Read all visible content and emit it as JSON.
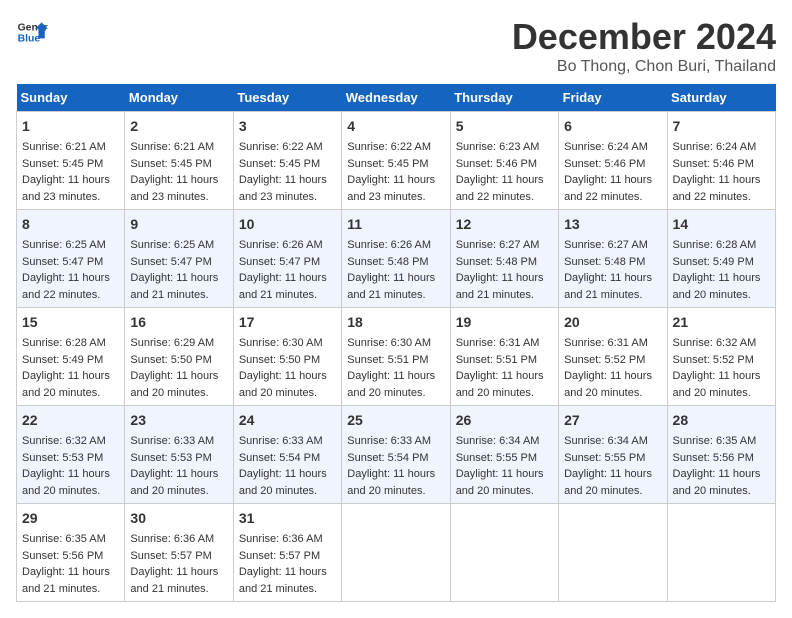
{
  "header": {
    "logo_line1": "General",
    "logo_line2": "Blue",
    "month_title": "December 2024",
    "location": "Bo Thong, Chon Buri, Thailand"
  },
  "weekdays": [
    "Sunday",
    "Monday",
    "Tuesday",
    "Wednesday",
    "Thursday",
    "Friday",
    "Saturday"
  ],
  "weeks": [
    [
      {
        "day": "1",
        "lines": [
          "Sunrise: 6:21 AM",
          "Sunset: 5:45 PM",
          "Daylight: 11 hours",
          "and 23 minutes."
        ]
      },
      {
        "day": "2",
        "lines": [
          "Sunrise: 6:21 AM",
          "Sunset: 5:45 PM",
          "Daylight: 11 hours",
          "and 23 minutes."
        ]
      },
      {
        "day": "3",
        "lines": [
          "Sunrise: 6:22 AM",
          "Sunset: 5:45 PM",
          "Daylight: 11 hours",
          "and 23 minutes."
        ]
      },
      {
        "day": "4",
        "lines": [
          "Sunrise: 6:22 AM",
          "Sunset: 5:45 PM",
          "Daylight: 11 hours",
          "and 23 minutes."
        ]
      },
      {
        "day": "5",
        "lines": [
          "Sunrise: 6:23 AM",
          "Sunset: 5:46 PM",
          "Daylight: 11 hours",
          "and 22 minutes."
        ]
      },
      {
        "day": "6",
        "lines": [
          "Sunrise: 6:24 AM",
          "Sunset: 5:46 PM",
          "Daylight: 11 hours",
          "and 22 minutes."
        ]
      },
      {
        "day": "7",
        "lines": [
          "Sunrise: 6:24 AM",
          "Sunset: 5:46 PM",
          "Daylight: 11 hours",
          "and 22 minutes."
        ]
      }
    ],
    [
      {
        "day": "8",
        "lines": [
          "Sunrise: 6:25 AM",
          "Sunset: 5:47 PM",
          "Daylight: 11 hours",
          "and 22 minutes."
        ]
      },
      {
        "day": "9",
        "lines": [
          "Sunrise: 6:25 AM",
          "Sunset: 5:47 PM",
          "Daylight: 11 hours",
          "and 21 minutes."
        ]
      },
      {
        "day": "10",
        "lines": [
          "Sunrise: 6:26 AM",
          "Sunset: 5:47 PM",
          "Daylight: 11 hours",
          "and 21 minutes."
        ]
      },
      {
        "day": "11",
        "lines": [
          "Sunrise: 6:26 AM",
          "Sunset: 5:48 PM",
          "Daylight: 11 hours",
          "and 21 minutes."
        ]
      },
      {
        "day": "12",
        "lines": [
          "Sunrise: 6:27 AM",
          "Sunset: 5:48 PM",
          "Daylight: 11 hours",
          "and 21 minutes."
        ]
      },
      {
        "day": "13",
        "lines": [
          "Sunrise: 6:27 AM",
          "Sunset: 5:48 PM",
          "Daylight: 11 hours",
          "and 21 minutes."
        ]
      },
      {
        "day": "14",
        "lines": [
          "Sunrise: 6:28 AM",
          "Sunset: 5:49 PM",
          "Daylight: 11 hours",
          "and 20 minutes."
        ]
      }
    ],
    [
      {
        "day": "15",
        "lines": [
          "Sunrise: 6:28 AM",
          "Sunset: 5:49 PM",
          "Daylight: 11 hours",
          "and 20 minutes."
        ]
      },
      {
        "day": "16",
        "lines": [
          "Sunrise: 6:29 AM",
          "Sunset: 5:50 PM",
          "Daylight: 11 hours",
          "and 20 minutes."
        ]
      },
      {
        "day": "17",
        "lines": [
          "Sunrise: 6:30 AM",
          "Sunset: 5:50 PM",
          "Daylight: 11 hours",
          "and 20 minutes."
        ]
      },
      {
        "day": "18",
        "lines": [
          "Sunrise: 6:30 AM",
          "Sunset: 5:51 PM",
          "Daylight: 11 hours",
          "and 20 minutes."
        ]
      },
      {
        "day": "19",
        "lines": [
          "Sunrise: 6:31 AM",
          "Sunset: 5:51 PM",
          "Daylight: 11 hours",
          "and 20 minutes."
        ]
      },
      {
        "day": "20",
        "lines": [
          "Sunrise: 6:31 AM",
          "Sunset: 5:52 PM",
          "Daylight: 11 hours",
          "and 20 minutes."
        ]
      },
      {
        "day": "21",
        "lines": [
          "Sunrise: 6:32 AM",
          "Sunset: 5:52 PM",
          "Daylight: 11 hours",
          "and 20 minutes."
        ]
      }
    ],
    [
      {
        "day": "22",
        "lines": [
          "Sunrise: 6:32 AM",
          "Sunset: 5:53 PM",
          "Daylight: 11 hours",
          "and 20 minutes."
        ]
      },
      {
        "day": "23",
        "lines": [
          "Sunrise: 6:33 AM",
          "Sunset: 5:53 PM",
          "Daylight: 11 hours",
          "and 20 minutes."
        ]
      },
      {
        "day": "24",
        "lines": [
          "Sunrise: 6:33 AM",
          "Sunset: 5:54 PM",
          "Daylight: 11 hours",
          "and 20 minutes."
        ]
      },
      {
        "day": "25",
        "lines": [
          "Sunrise: 6:33 AM",
          "Sunset: 5:54 PM",
          "Daylight: 11 hours",
          "and 20 minutes."
        ]
      },
      {
        "day": "26",
        "lines": [
          "Sunrise: 6:34 AM",
          "Sunset: 5:55 PM",
          "Daylight: 11 hours",
          "and 20 minutes."
        ]
      },
      {
        "day": "27",
        "lines": [
          "Sunrise: 6:34 AM",
          "Sunset: 5:55 PM",
          "Daylight: 11 hours",
          "and 20 minutes."
        ]
      },
      {
        "day": "28",
        "lines": [
          "Sunrise: 6:35 AM",
          "Sunset: 5:56 PM",
          "Daylight: 11 hours",
          "and 20 minutes."
        ]
      }
    ],
    [
      {
        "day": "29",
        "lines": [
          "Sunrise: 6:35 AM",
          "Sunset: 5:56 PM",
          "Daylight: 11 hours",
          "and 21 minutes."
        ]
      },
      {
        "day": "30",
        "lines": [
          "Sunrise: 6:36 AM",
          "Sunset: 5:57 PM",
          "Daylight: 11 hours",
          "and 21 minutes."
        ]
      },
      {
        "day": "31",
        "lines": [
          "Sunrise: 6:36 AM",
          "Sunset: 5:57 PM",
          "Daylight: 11 hours",
          "and 21 minutes."
        ]
      },
      null,
      null,
      null,
      null
    ]
  ]
}
